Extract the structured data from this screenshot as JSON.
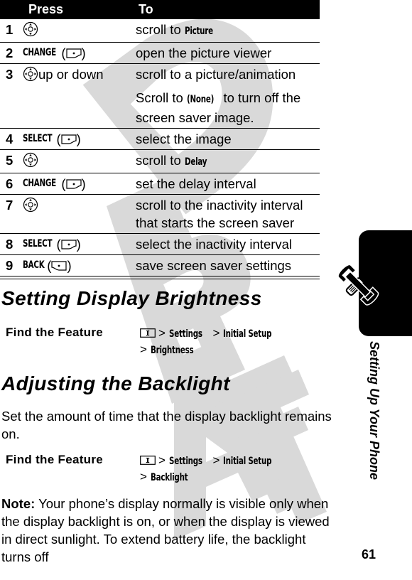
{
  "table": {
    "headers": {
      "press": "Press",
      "to": "To"
    },
    "rows": [
      {
        "num": "1",
        "press_icon": "nav-key-icon",
        "press_key": "",
        "press_text": "",
        "to_pre": "scroll to ",
        "to_kw": "Picture",
        "to_post": ""
      },
      {
        "num": "2",
        "press_icon": "right-soft-key-icon",
        "press_key": "CHANGE",
        "press_text": "",
        "to_pre": "open the picture viewer",
        "to_kw": "",
        "to_post": ""
      },
      {
        "num": "3",
        "press_icon": "nav-key-icon",
        "press_key": "",
        "press_text": " up or down",
        "to_pre": "scroll to a picture/animation",
        "to_kw": "",
        "to_post": "",
        "to_note_pre": "Scroll to ",
        "to_note_kw": "(None)",
        "to_note_post": " to turn off the screen saver image."
      },
      {
        "num": "4",
        "press_icon": "right-soft-key-icon",
        "press_key": "SELECT",
        "press_text": "",
        "to_pre": "select the image",
        "to_kw": "",
        "to_post": ""
      },
      {
        "num": "5",
        "press_icon": "nav-key-icon",
        "press_key": "",
        "press_text": "",
        "to_pre": "scroll to ",
        "to_kw": "Delay",
        "to_post": ""
      },
      {
        "num": "6",
        "press_icon": "right-soft-key-icon",
        "press_key": "CHANGE",
        "press_text": "",
        "to_pre": "set the delay interval",
        "to_kw": "",
        "to_post": ""
      },
      {
        "num": "7",
        "press_icon": "nav-key-icon",
        "press_key": "",
        "press_text": "",
        "to_pre": "scroll to the inactivity interval that starts the screen saver",
        "to_kw": "",
        "to_post": ""
      },
      {
        "num": "8",
        "press_icon": "right-soft-key-icon",
        "press_key": "SELECT",
        "press_text": "",
        "to_pre": "select the inactivity interval",
        "to_kw": "",
        "to_post": ""
      },
      {
        "num": "9",
        "press_icon": "left-soft-key-icon",
        "press_key": "BACK",
        "press_text": "",
        "to_pre": "save screen saver settings",
        "to_kw": "",
        "to_post": ""
      }
    ]
  },
  "brightness": {
    "heading": "Setting Display Brightness",
    "find_label": "Find the Feature",
    "path": [
      "Settings",
      "Initial Setup",
      "Brightness"
    ]
  },
  "backlight": {
    "heading": "Adjusting the Backlight",
    "intro": "Set the amount of time that the display backlight remains on.",
    "find_label": "Find the Feature",
    "path": [
      "Settings",
      "Initial Setup",
      "Backlight"
    ]
  },
  "note": {
    "label": "Note:",
    "text": " Your phone’s display normally is visible only when the display backlight is on, or when the display is viewed in direct sunlight. To extend battery life, the backlight turns off"
  },
  "sidebar": {
    "section_title": "Setting Up Your Phone",
    "icon": "tools-icon"
  },
  "page_number": "61",
  "watermark": "DRAFT",
  "colors": {
    "watermark": "#d9d9d9",
    "ink": "#000000"
  }
}
